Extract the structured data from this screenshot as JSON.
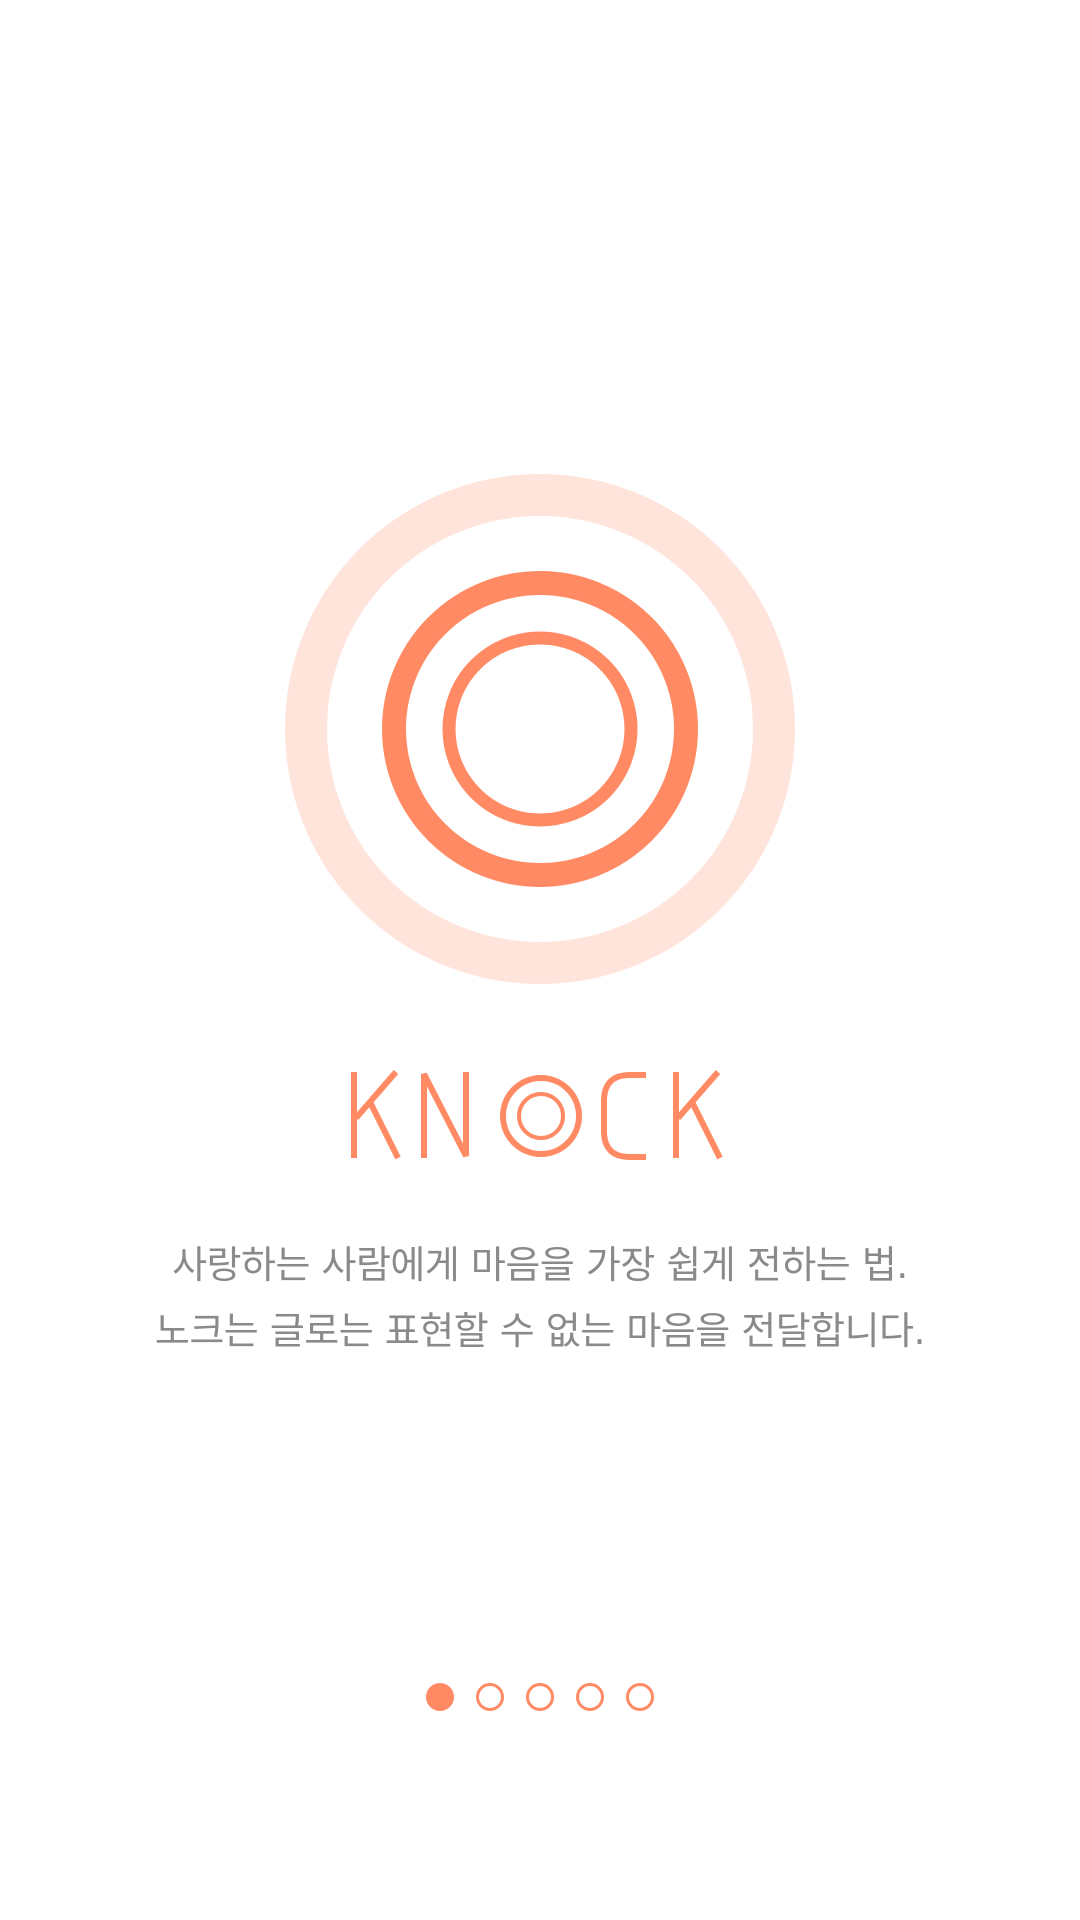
{
  "app": {
    "brand_name": "KNOCK",
    "accent_color": "#ff8a64",
    "ring_light_color": "#ffe4dc"
  },
  "intro": {
    "line1": "사랑하는 사람에게 마음을 가장 쉽게 전하는 법.",
    "line2": "노크는 글로는 표현할 수 없는 마음을 전달합니다."
  },
  "pager": {
    "total_pages": 5,
    "current_page": 1
  }
}
